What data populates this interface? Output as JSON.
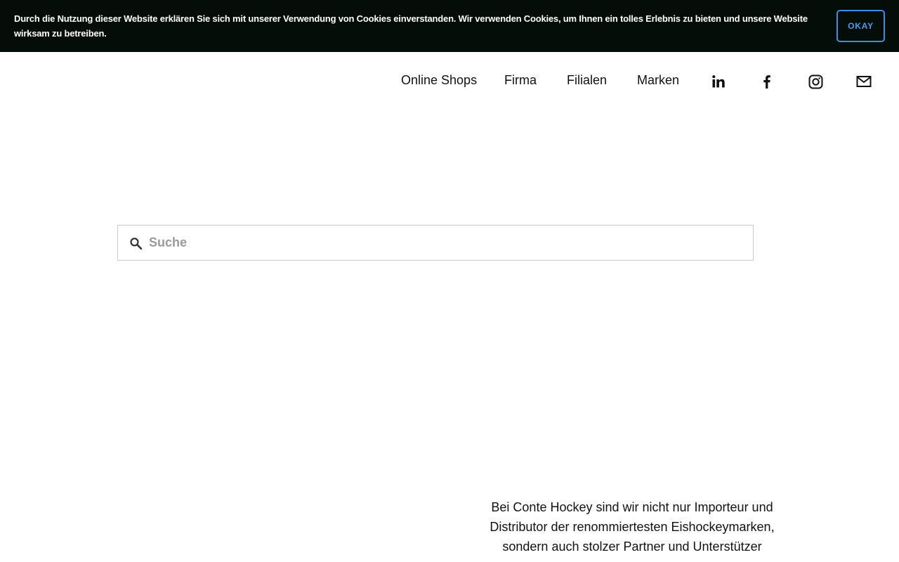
{
  "cookie_banner": {
    "text": "Durch die Nutzung dieser Website erklären Sie sich mit unserer Verwendung von Cookies einverstanden. Wir verwenden Cookies, um Ihnen ein tolles Erlebnis zu bieten und unsere Website wirksam zu betreiben.",
    "button_label": "OKAY",
    "accent_color": "#3b8de8",
    "background_color": "#050d08"
  },
  "nav": {
    "links": [
      {
        "label": "Online Shops"
      },
      {
        "label": "Firma"
      },
      {
        "label": "Filialen"
      },
      {
        "label": "Marken"
      }
    ],
    "social": [
      {
        "icon": "linkedin-icon"
      },
      {
        "icon": "facebook-icon"
      },
      {
        "icon": "instagram-icon"
      },
      {
        "icon": "mail-icon"
      }
    ]
  },
  "search": {
    "placeholder": "Suche",
    "value": ""
  },
  "intro": {
    "text": "Bei Conte Hockey sind wir nicht nur Importeur und Distributor der renommiertesten Eishockeymarken, sondern auch stolzer Partner und Unterstützer"
  }
}
